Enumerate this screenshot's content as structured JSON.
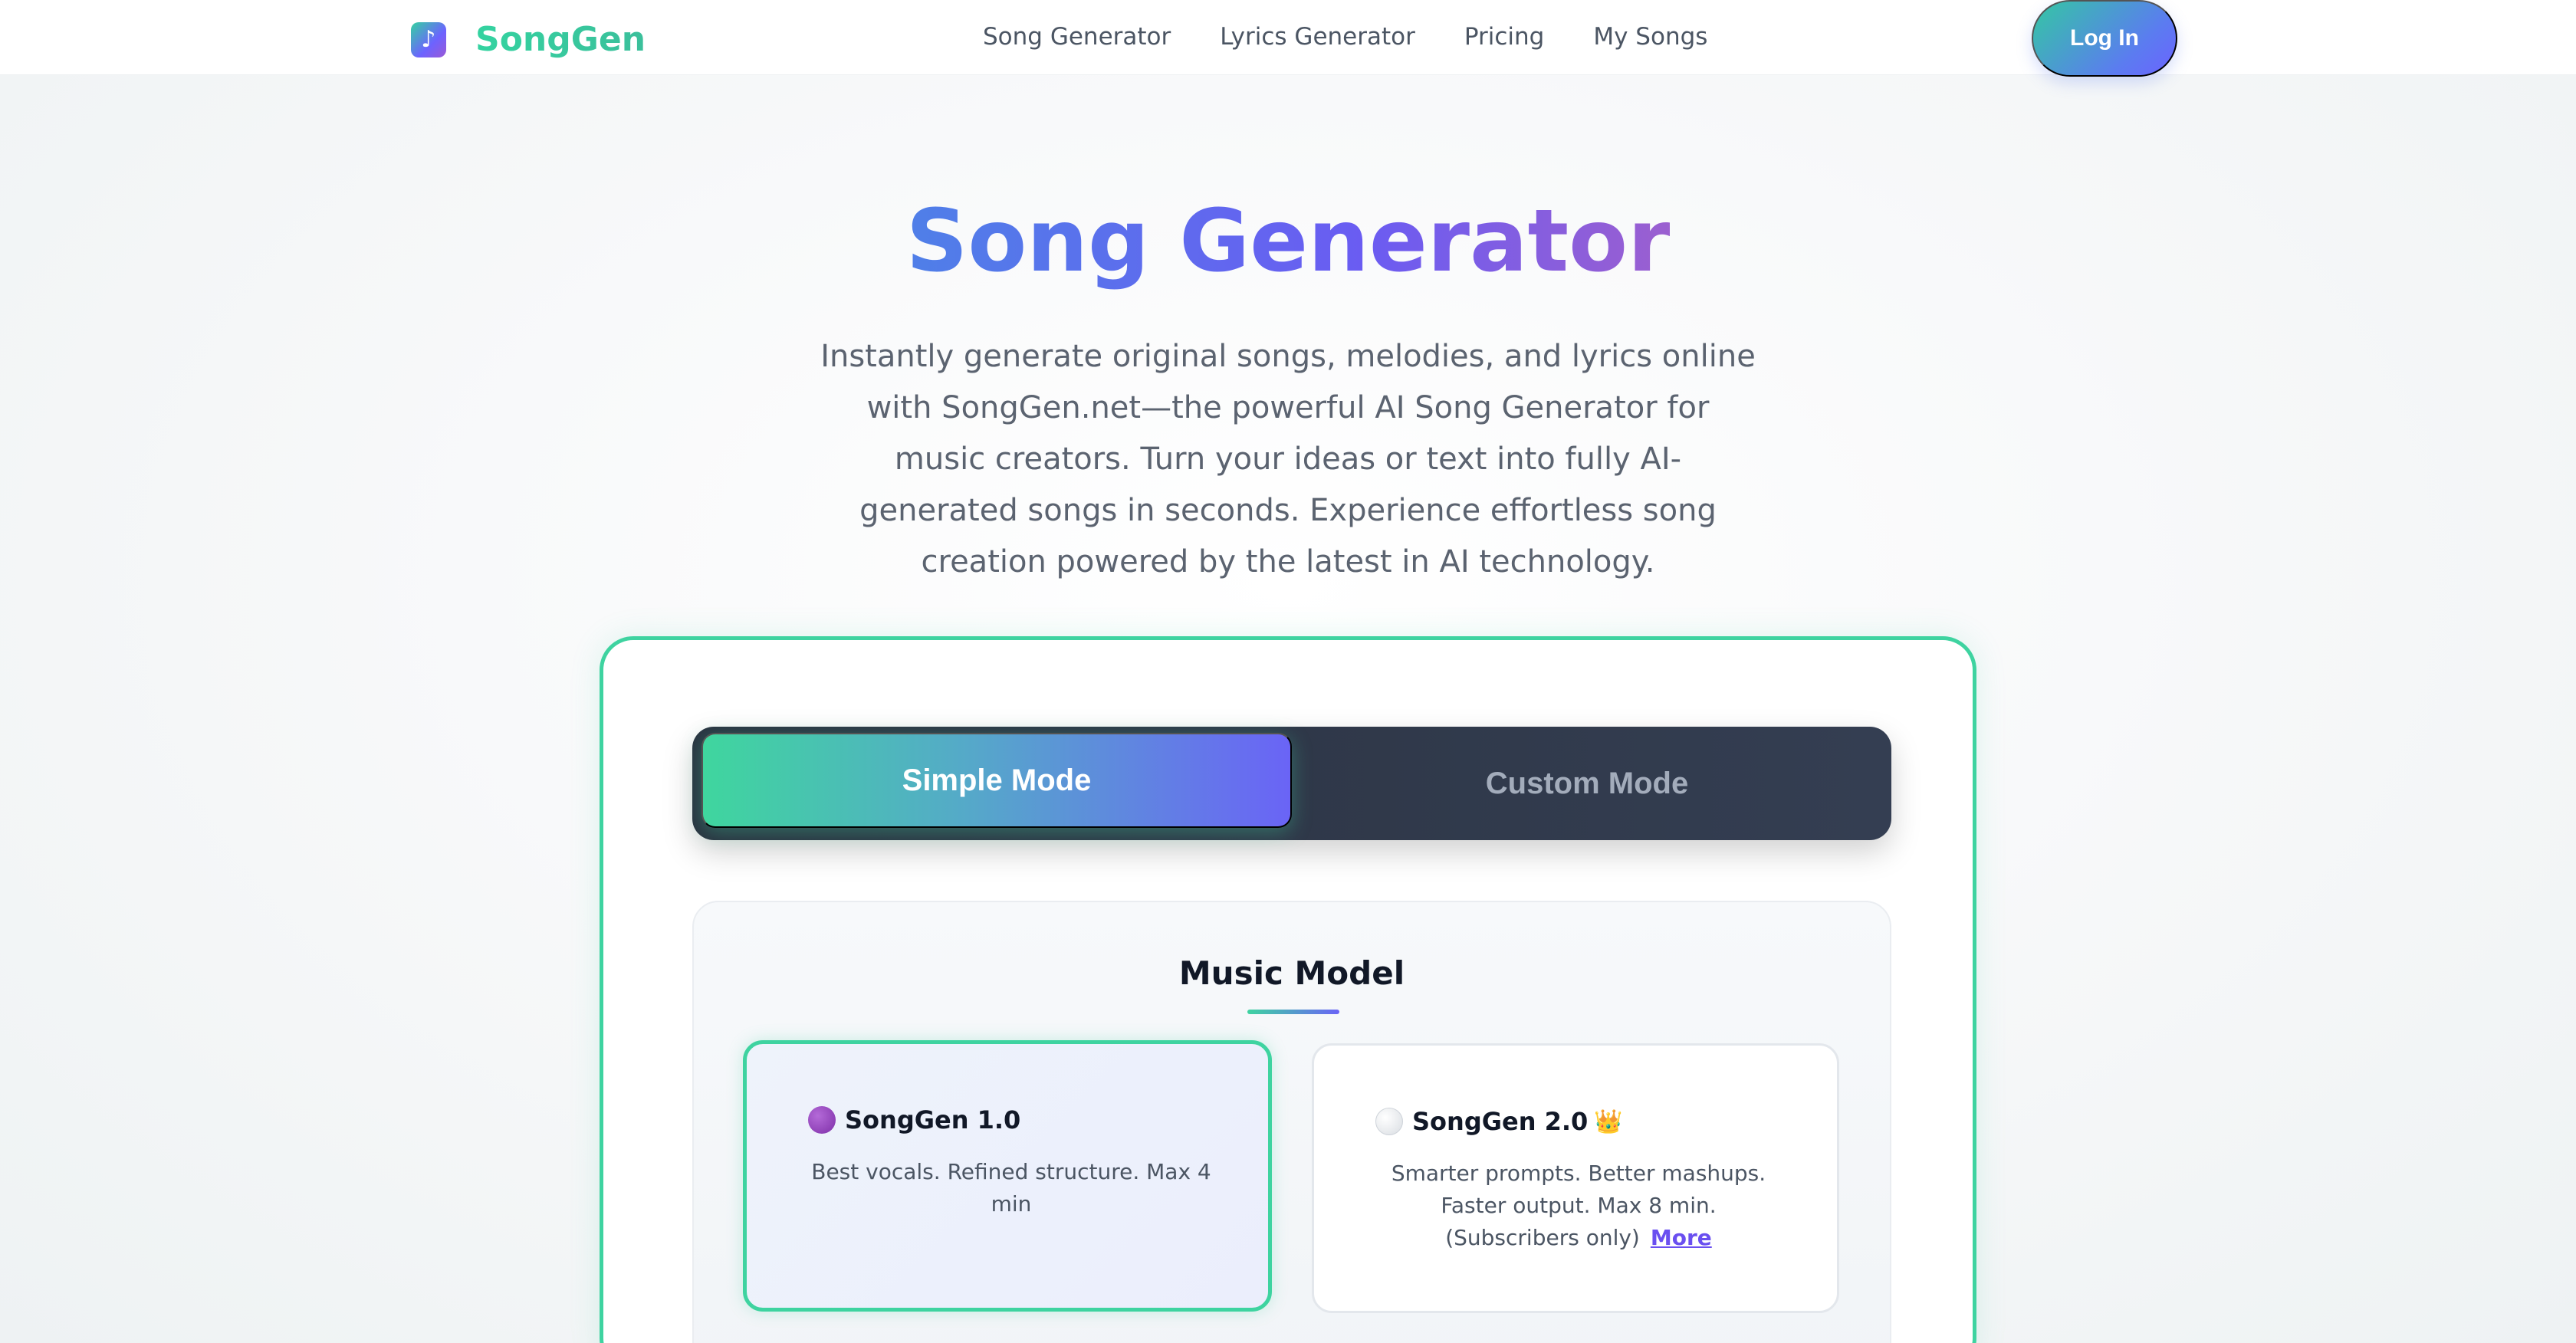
{
  "nav": {
    "logo_glyph": "♪",
    "brand": "SongGen",
    "links": [
      "Song Generator",
      "Lyrics Generator",
      "Pricing",
      "My Songs"
    ],
    "login": "Log In"
  },
  "hero": {
    "title": "Song Generator",
    "description": "Instantly generate original songs, melodies, and lyrics online with SongGen.net—the powerful AI Song Generator for music creators. Turn your ideas or text into fully AI-generated songs in seconds. Experience effortless song creation powered by the latest in AI technology."
  },
  "modes": {
    "simple": "Simple Mode",
    "custom": "Custom Mode",
    "selected": "Simple Mode"
  },
  "models": {
    "heading": "Music Model",
    "items": [
      {
        "name": "SongGen 1.0",
        "description": "Best vocals. Refined structure. Max 4 min",
        "selected": true
      },
      {
        "name": "SongGen 2.0",
        "badge": "👑",
        "description": "Smarter prompts. Better mashups. Faster output. Max 8 min. (Subscribers only)",
        "more": "More",
        "selected": false
      }
    ]
  },
  "colors": {
    "accent_green": "#3ed3a0",
    "accent_purple": "#6a64f6",
    "toggle_dark": "#2a3240"
  }
}
